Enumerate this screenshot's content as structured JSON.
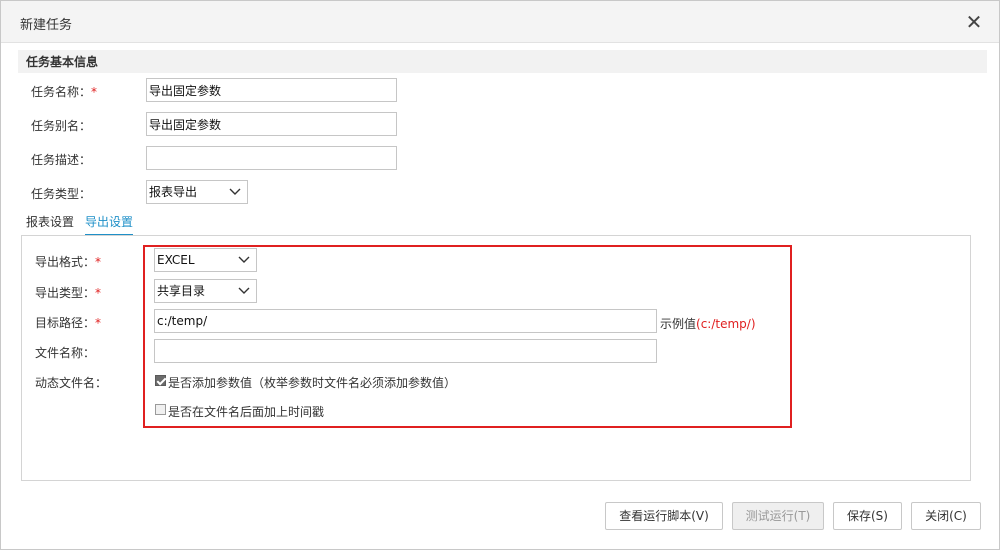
{
  "dialog": {
    "title": "新建任务",
    "close_glyph": "✕"
  },
  "basic_section": {
    "title": "任务基本信息"
  },
  "fields": {
    "task_name": {
      "label": "任务名称：",
      "required": "*",
      "value": "导出固定参数"
    },
    "task_alias": {
      "label": "任务别名：",
      "value": "导出固定参数"
    },
    "task_desc": {
      "label": "任务描述：",
      "value": ""
    },
    "task_type": {
      "label": "任务类型：",
      "value": "报表导出"
    }
  },
  "tabs": [
    {
      "label": "报表设置",
      "active": false
    },
    {
      "label": "导出设置",
      "active": true
    }
  ],
  "export": {
    "format": {
      "label": "导出格式：",
      "required": "*",
      "value": "EXCEL"
    },
    "type": {
      "label": "导出类型：",
      "required": "*",
      "value": "共享目录"
    },
    "target_path": {
      "label": "目标路径：",
      "required": "*",
      "value": "c:/temp/",
      "hint_prefix": "示例值",
      "hint_value": "(c:/temp/)"
    },
    "file_name": {
      "label": "文件名称：",
      "value": ""
    },
    "dynamic_name": {
      "label": "动态文件名：",
      "option_params": {
        "label": "是否添加参数值（枚举参数时文件名必须添加参数值）",
        "checked": true
      },
      "option_timestamp": {
        "label": "是否在文件名后面加上时间戳",
        "checked": false
      }
    }
  },
  "buttons": {
    "view_script": "查看运行脚本(V)",
    "test_run": "测试运行(T)",
    "save": "保存(S)",
    "close": "关闭(C)"
  },
  "colors": {
    "required": "#e02020",
    "tab_active": "#1f90c8",
    "highlight_border": "#e02020"
  },
  "icons": {
    "close": "close-icon",
    "dropdown": "chevron-down-icon",
    "check": "checkbox-icon"
  }
}
